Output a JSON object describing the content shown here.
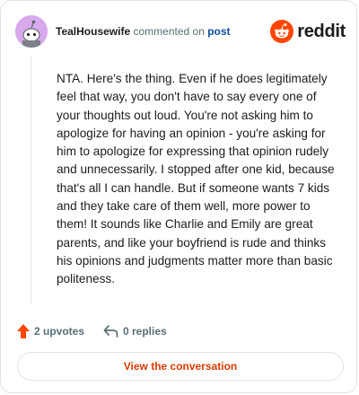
{
  "header": {
    "username": "TealHousewife",
    "commented_on": "commented on",
    "post_link": "post",
    "brand": "reddit",
    "avatar_icon": "snoo-avatar-icon",
    "brand_icon": "reddit-logo-icon",
    "brand_color": "#ff4500"
  },
  "comment": {
    "text": "NTA. Here's the thing. Even if he does legitimately feel that way, you don't have to say every one of your thoughts out loud. You're not asking him to apologize for having an opinion - you're asking for him to apologize for expressing that opinion rudely and unnecessarily. I stopped after one kid, because that's all I can handle. But if someone wants 7 kids and they take care of them well, more power to them! It sounds like Charlie and Emily are great parents, and like your boyfriend is rude and thinks his opinions and judgments matter more than basic politeness."
  },
  "actions": {
    "upvotes": "2 upvotes",
    "replies": "0 replies",
    "upvote_icon": "upvote-arrow-icon",
    "reply_icon": "reply-arrow-icon",
    "upvote_color": "#ff4500"
  },
  "cta": {
    "label": "View the conversation"
  }
}
